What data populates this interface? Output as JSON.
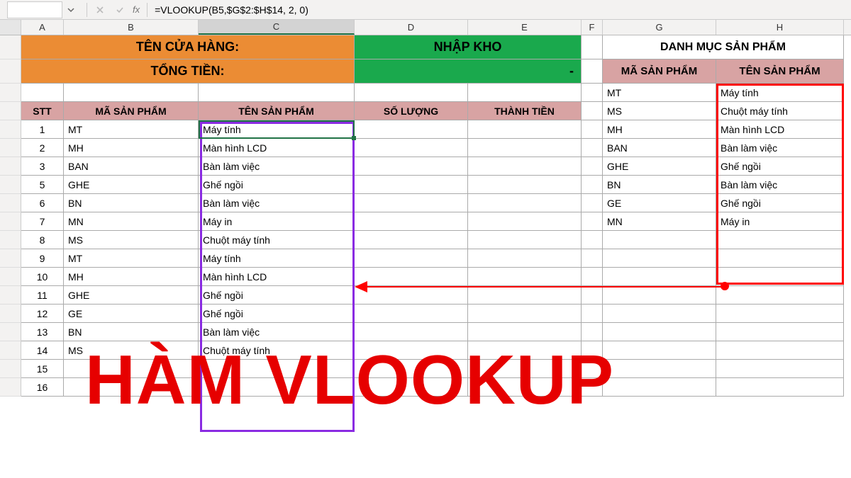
{
  "formula_bar": {
    "namebox": "",
    "fx_label": "fx",
    "formula": "=VLOOKUP(B5,$G$2:$H$14, 2, 0)"
  },
  "columns": [
    "A",
    "B",
    "C",
    "D",
    "E",
    "F",
    "G",
    "H"
  ],
  "active_column": "C",
  "header": {
    "store_label": "TÊN CỬA HÀNG:",
    "total_label": "TỔNG TIỀN:",
    "import_label": "NHẬP KHO",
    "dash": "-",
    "catalog_title": "DANH MỤC SẢN PHẨM",
    "ma_sp": "MÃ SẢN PHẨM",
    "ten_sp": "TÊN SẢN PHẨM"
  },
  "blank_row_num": "",
  "table_headers": {
    "stt": "STT",
    "ma": "MÃ SẢN PHẨM",
    "ten": "TÊN SẢN PHẨM",
    "sl": "SỐ LƯỢNG",
    "tt": "THÀNH TIỀN"
  },
  "rows": [
    {
      "stt": "1",
      "ma": "MT",
      "ten": "Máy tính"
    },
    {
      "stt": "2",
      "ma": "MH",
      "ten": "Màn hình LCD"
    },
    {
      "stt": "3",
      "ma": "BAN",
      "ten": "Bàn làm việc"
    },
    {
      "stt": "5",
      "ma": "GHE",
      "ten": "Ghế ngồi"
    },
    {
      "stt": "6",
      "ma": "BN",
      "ten": "Bàn làm việc"
    },
    {
      "stt": "7",
      "ma": "MN",
      "ten": "Máy in"
    },
    {
      "stt": "8",
      "ma": "MS",
      "ten": "Chuột máy tính"
    },
    {
      "stt": "9",
      "ma": "MT",
      "ten": "Máy tính"
    },
    {
      "stt": "10",
      "ma": "MH",
      "ten": "Màn hình LCD"
    },
    {
      "stt": "11",
      "ma": "GHE",
      "ten": "Ghế ngồi"
    },
    {
      "stt": "12",
      "ma": "GE",
      "ten": "Ghế ngồi"
    },
    {
      "stt": "13",
      "ma": "BN",
      "ten": "Bàn làm việc"
    },
    {
      "stt": "14",
      "ma": "MS",
      "ten": "Chuột máy tính"
    },
    {
      "stt": "15",
      "ma": "",
      "ten": ""
    },
    {
      "stt": "16",
      "ma": "",
      "ten": ""
    }
  ],
  "catalog": [
    {
      "ma": "MT",
      "ten": "Máy tính"
    },
    {
      "ma": "MS",
      "ten": "Chuột máy tính"
    },
    {
      "ma": "MH",
      "ten": "Màn hình LCD"
    },
    {
      "ma": "BAN",
      "ten": "Bàn làm việc"
    },
    {
      "ma": "GHE",
      "ten": "Ghế ngồi"
    },
    {
      "ma": "BN",
      "ten": "Bàn làm việc"
    },
    {
      "ma": "GE",
      "ten": "Ghế ngồi"
    },
    {
      "ma": "MN",
      "ten": "Máy in"
    }
  ],
  "overlay_title": "HÀM VLOOKUP"
}
